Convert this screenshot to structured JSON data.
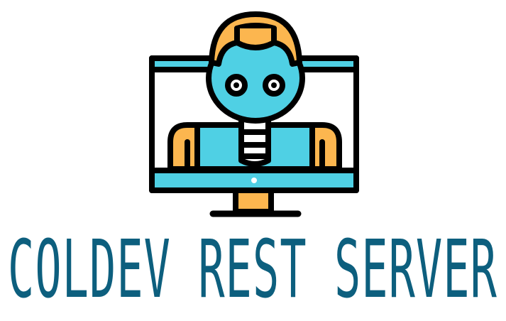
{
  "logo": {
    "name": "robot-monitor-logo",
    "colors": {
      "outline": "#000000",
      "screen": "#4fd0e4",
      "accent": "#fcb64f",
      "text": "#0d5f7e",
      "background": "#ffffff"
    }
  },
  "title": {
    "text": "COLDEV REST SERVER"
  }
}
